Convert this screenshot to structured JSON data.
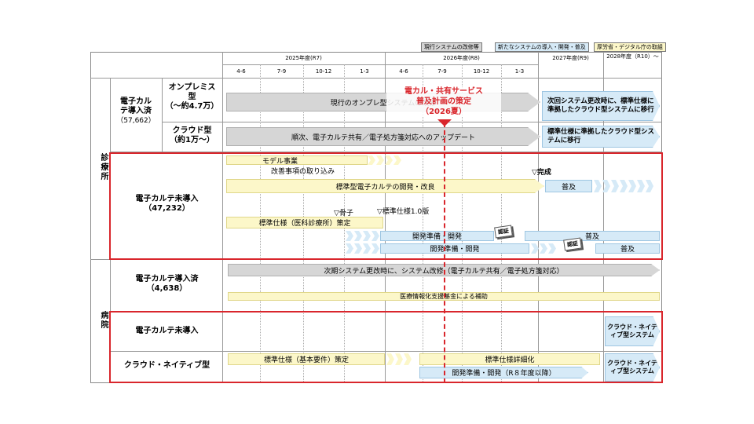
{
  "legend": {
    "items": [
      {
        "label": "現行システムの改修等",
        "color": "#d6d6d6"
      },
      {
        "label": "新たなシステムの導入・開発・普及",
        "color": "#d6eaf7"
      },
      {
        "label": "厚労省・デジタル庁の取組",
        "color": "#fcf7c9"
      }
    ]
  },
  "header": {
    "years": [
      "2025年度(R7)",
      "2026年度(R8)",
      "2027年度(R9)",
      "2028年度（R10）～"
    ],
    "quarters": [
      "4-6",
      "7-9",
      "10-12",
      "1-3",
      "4-6",
      "7-9",
      "10-12",
      "1-3"
    ]
  },
  "callout": {
    "line1": "電カル・共有サービス",
    "line2": "普及計画の策定",
    "line3": "（2026夏）"
  },
  "clinic": {
    "group_label": "診療所",
    "adopted": {
      "label_line1": "電子カル",
      "label_line2": "テ導入済",
      "label_line3": "（57,662）",
      "onprem_line1": "オンプレミス",
      "onprem_line2": "型",
      "onprem_line3": "（～約4.7万）",
      "onprem_bar": "現行のオンプレ型システムの改修",
      "onprem_next": "次回システム更改時に、標準仕様に準拠したクラウド型システムに移行",
      "cloud_line1": "クラウド型",
      "cloud_line2": "（約1万～）",
      "cloud_bar": "順次、電子カルテ共有／電子処方箋対応へのアップデート",
      "cloud_next": "標準仕様に準拠したクラウド型システムに移行"
    },
    "not_adopted": {
      "label_line1": "電子カルテ未導入",
      "label_line2": "（47,232）",
      "model": "モデル事業",
      "improve": "改善事項の取り込み",
      "dev_bar": "標準型電子カルテの開発・改良",
      "complete": "▽完成",
      "spread1": "普及",
      "skeleton": "▽骨子",
      "spec_v1": "▽標準仕様1.0版",
      "spec_bar": "標準仕様（医科診療所）策定",
      "prep1": "開発準備・開発",
      "cert1": "認証",
      "spread2": "普及",
      "prep2": "開発準備・開発",
      "cert2": "認証",
      "spread3": "普及"
    }
  },
  "hospital": {
    "group_label": "病院",
    "adopted": {
      "label_line1": "電子カルテ導入済",
      "label_line2": "（4,638）",
      "bar": "次期システム更改時に、システム改修（電子カルテ共有／電子処方箋対応）",
      "fund": "医療情報化支援基金による補助"
    },
    "not_adopted": {
      "label": "電子カルテ未導入",
      "cloud_native": "クラウド・ネイティブ型システム"
    },
    "cloud_native": {
      "label": "クラウド・ネイティブ型",
      "spec_bar": "標準仕様（基本要件）策定",
      "detail_bar": "標準仕様詳細化",
      "prep_bar": "開発準備・開発（R８年度以降）",
      "cloud_native": "クラウド・ネイティブ型システム"
    }
  }
}
